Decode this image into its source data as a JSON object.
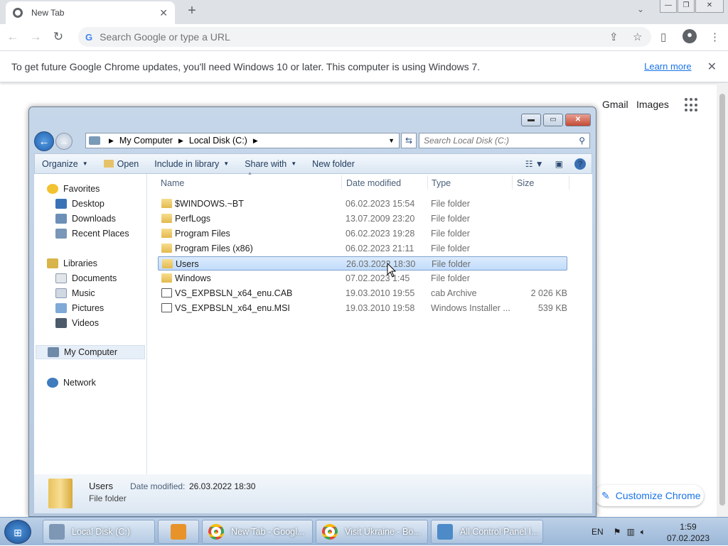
{
  "browser": {
    "tab_title": "New Tab",
    "tab_close": "✕",
    "new_tab": "+",
    "omnibox_placeholder": "Search Google or type a URL",
    "window_minimize": "—",
    "window_restore": "❐",
    "window_close": "✕",
    "infobar_message": "To get future Google Chrome updates, you'll need Windows 10 or later. This computer is using Windows 7.",
    "infobar_link": "Learn more",
    "infobar_close": "✕",
    "ntp_gmail": "Gmail",
    "ntp_images": "Images",
    "customize_label": "Customize Chrome"
  },
  "explorer": {
    "breadcrumb": [
      "My Computer",
      "Local Disk (C:)"
    ],
    "search_placeholder": "Search Local Disk (C:)",
    "commands": {
      "organize": "Organize",
      "open": "Open",
      "include": "Include in library",
      "share": "Share with",
      "new_folder": "New folder"
    },
    "nav": {
      "favorites": "Favorites",
      "desktop": "Desktop",
      "downloads": "Downloads",
      "recent": "Recent Places",
      "libraries": "Libraries",
      "documents": "Documents",
      "music": "Music",
      "pictures": "Pictures",
      "videos": "Videos",
      "computer": "My Computer",
      "network": "Network"
    },
    "columns": {
      "name": "Name",
      "date": "Date modified",
      "type": "Type",
      "size": "Size"
    },
    "files": [
      {
        "name": "$WINDOWS.~BT",
        "date": "06.02.2023 15:54",
        "type": "File folder",
        "size": ""
      },
      {
        "name": "PerfLogs",
        "date": "13.07.2009 23:20",
        "type": "File folder",
        "size": ""
      },
      {
        "name": "Program Files",
        "date": "06.02.2023 19:28",
        "type": "File folder",
        "size": ""
      },
      {
        "name": "Program Files (x86)",
        "date": "06.02.2023 21:11",
        "type": "File folder",
        "size": ""
      },
      {
        "name": "Users",
        "date": "26.03.2022 18:30",
        "type": "File folder",
        "size": ""
      },
      {
        "name": "Windows",
        "date": "07.02.2023 1:45",
        "type": "File folder",
        "size": ""
      },
      {
        "name": "VS_EXPBSLN_x64_enu.CAB",
        "date": "19.03.2010 19:55",
        "type": "cab Archive",
        "size": "2 026 KB"
      },
      {
        "name": "VS_EXPBSLN_x64_enu.MSI",
        "date": "19.03.2010 19:58",
        "type": "Windows Installer ...",
        "size": "539 KB"
      }
    ],
    "details": {
      "name": "Users",
      "type": "File folder",
      "modified_label": "Date modified:",
      "modified_value": "26.03.2022 18:30"
    }
  },
  "taskbar": {
    "items": [
      "Local Disk (C:)",
      "New Tab - Googl...",
      "Visit Ukraine - Bo...",
      "All Control Panel I..."
    ],
    "lang": "EN",
    "time": "1:59",
    "date": "07.02.2023"
  }
}
